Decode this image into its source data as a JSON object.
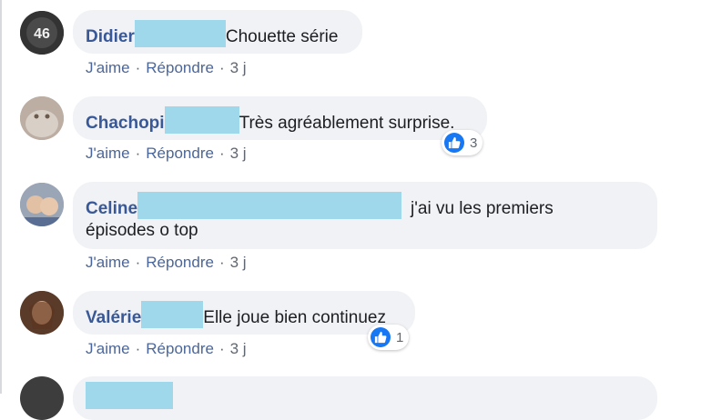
{
  "comments": [
    {
      "author": "Didier",
      "text": "Chouette série",
      "actions": {
        "like": "J'aime",
        "reply": "Répondre",
        "time": "3 j"
      }
    },
    {
      "author": "Chachopi",
      "text": "Très agréablement surprise.",
      "reaction_count": "3",
      "actions": {
        "like": "J'aime",
        "reply": "Répondre",
        "time": "3 j"
      }
    },
    {
      "author": "Celine",
      "text_line1": "j'ai vu les premiers",
      "text_line2": "épisodes o top",
      "actions": {
        "like": "J'aime",
        "reply": "Répondre",
        "time": "3 j"
      }
    },
    {
      "author": "Valérie",
      "text": "Elle joue bien continuez",
      "reaction_count": "1",
      "actions": {
        "like": "J'aime",
        "reply": "Répondre",
        "time": "3 j"
      }
    }
  ],
  "colors": {
    "author": "#385898",
    "bubble": "#f0f2f5",
    "like_blue": "#1877f2",
    "redaction": "#9fd8ea"
  },
  "icons": {
    "reaction": "thumbs-up-icon"
  }
}
